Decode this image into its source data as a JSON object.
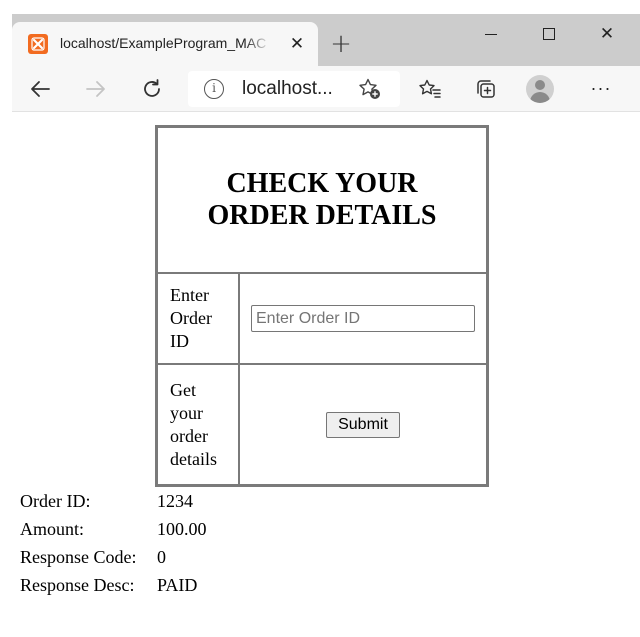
{
  "browser": {
    "tab": {
      "title": "localhost/ExampleProgram_MAC",
      "favicon_icon": "xampp-icon",
      "close_glyph": "✕"
    },
    "new_tab_glyph": "+",
    "window_controls": {
      "close_glyph": "✕"
    },
    "toolbar": {
      "address_text": "localhost...",
      "info_glyph": "i",
      "more_glyph": "···"
    }
  },
  "page": {
    "heading": "CHECK YOUR ORDER DETAILS",
    "order_id_label": "Enter Order ID",
    "order_id_value": "",
    "order_id_placeholder": "Enter Order ID",
    "submit_label": "Get your order details",
    "submit_button": "Submit"
  },
  "results": [
    {
      "key": "Order ID:",
      "value": "1234"
    },
    {
      "key": "Amount:",
      "value": "100.00"
    },
    {
      "key": "Response Code:",
      "value": "0"
    },
    {
      "key": "Response Desc:",
      "value": "PAID"
    }
  ],
  "colors": {
    "titlebar": "#cccccc",
    "toolbar": "#f7f7f7",
    "favicon": "#f26b20",
    "table_border": "#7a7a7a"
  }
}
